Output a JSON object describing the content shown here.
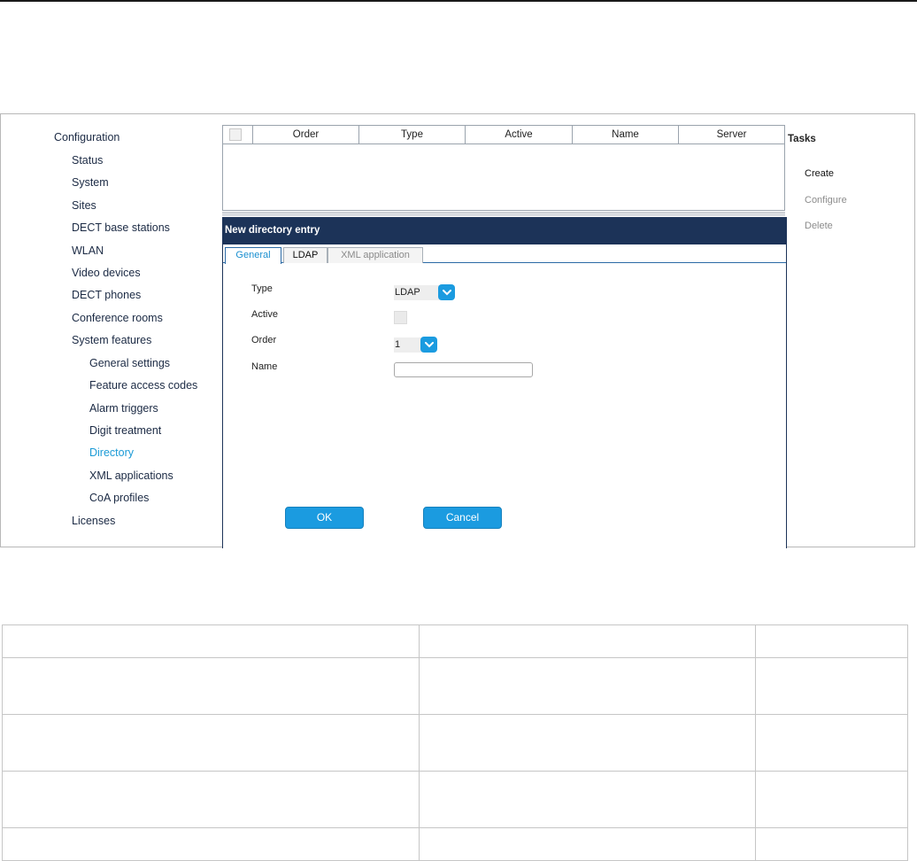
{
  "nav": [
    {
      "label": "Configuration",
      "level": 0
    },
    {
      "label": "Status",
      "level": 1
    },
    {
      "label": "System",
      "level": 1
    },
    {
      "label": "Sites",
      "level": 1
    },
    {
      "label": "DECT base stations",
      "level": 1
    },
    {
      "label": "WLAN",
      "level": 1
    },
    {
      "label": "Video devices",
      "level": 1
    },
    {
      "label": "DECT phones",
      "level": 1
    },
    {
      "label": "Conference rooms",
      "level": 1
    },
    {
      "label": "System features",
      "level": 1
    },
    {
      "label": "General settings",
      "level": 2
    },
    {
      "label": "Feature access codes",
      "level": 2
    },
    {
      "label": "Alarm triggers",
      "level": 2
    },
    {
      "label": "Digit treatment",
      "level": 2
    },
    {
      "label": "Directory",
      "level": 2,
      "active": true
    },
    {
      "label": "XML applications",
      "level": 2
    },
    {
      "label": "CoA profiles",
      "level": 2
    },
    {
      "label": "Licenses",
      "level": 1
    }
  ],
  "grid": {
    "columns": [
      "Order",
      "Type",
      "Active",
      "Name",
      "Server"
    ],
    "rows": []
  },
  "panel": {
    "title": "New directory entry",
    "tabs": [
      {
        "label": "General",
        "state": "active"
      },
      {
        "label": "LDAP",
        "state": "normal"
      },
      {
        "label": "XML application",
        "state": "disabled"
      }
    ],
    "fields": {
      "type_label": "Type",
      "type_value": "LDAP",
      "active_label": "Active",
      "active_checked": false,
      "order_label": "Order",
      "order_value": "1",
      "name_label": "Name",
      "name_value": ""
    },
    "ok_label": "OK",
    "cancel_label": "Cancel"
  },
  "tasks": {
    "title": "Tasks",
    "items": [
      {
        "label": "Create",
        "enabled": true
      },
      {
        "label": "Configure",
        "enabled": false
      },
      {
        "label": "Delete",
        "enabled": false
      }
    ]
  },
  "colors": {
    "nav_text": "#1b2a44",
    "nav_active": "#1a9ad6",
    "panel_header": "#1c3358",
    "accent_button": "#1b9be0"
  },
  "icons": {
    "select_dropdown": "chevron-down-icon"
  }
}
